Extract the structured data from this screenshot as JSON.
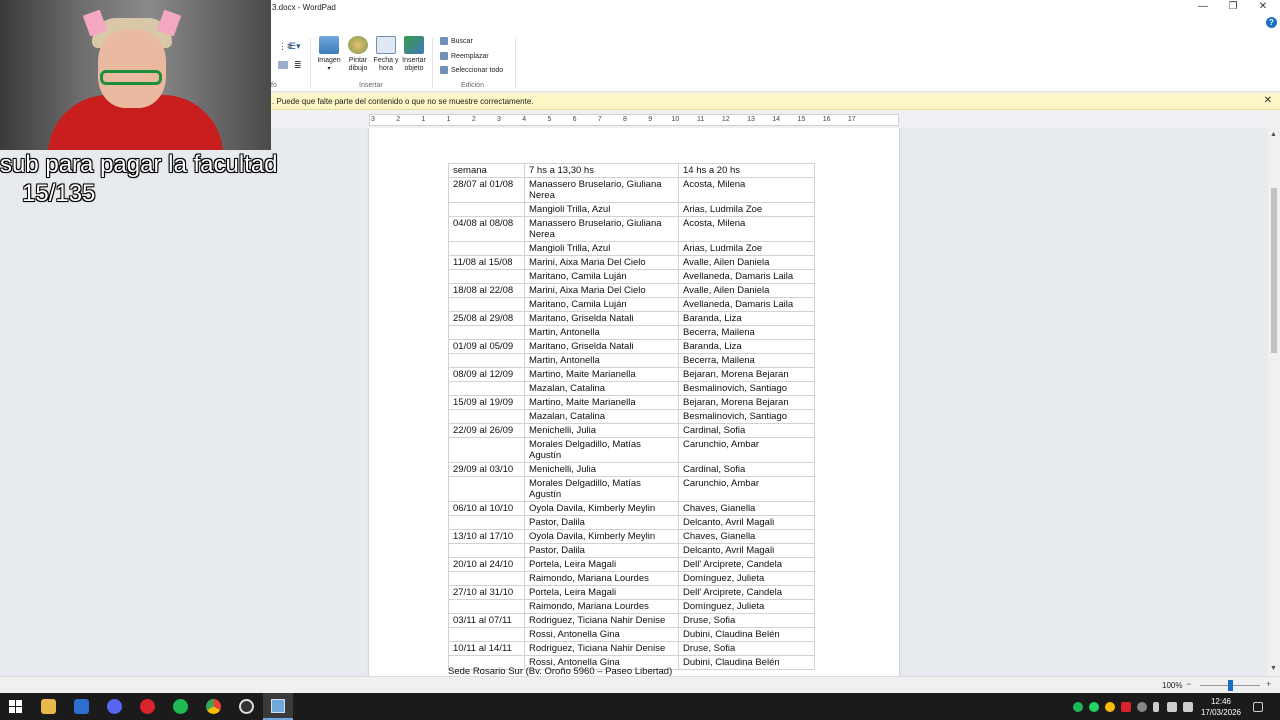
{
  "window": {
    "title": "3.docx - WordPad",
    "minimize": "—",
    "restore": "❐",
    "close": "✕",
    "help": "?"
  },
  "ribbon": {
    "insert_group_label": "Insertar",
    "edit_group_label": "Edición",
    "left_group_label_fragment": "fo",
    "image_label": "Imagen",
    "paint_label": "Pintar dibujo",
    "datetime_label": "Fecha y hora",
    "object_label": "Insertar objeto",
    "find_label": "Buscar",
    "replace_label": "Reemplazar",
    "select_all_label": "Seleccionar todo"
  },
  "infobar": {
    "message": ". Puede que falte parte del contenido o que no se muestre correctamente.",
    "close": "✕"
  },
  "ruler": {
    "ticks": [
      "3",
      "2",
      "1",
      "1",
      "2",
      "3",
      "4",
      "5",
      "6",
      "7",
      "8",
      "9",
      "10",
      "11",
      "12",
      "13",
      "14",
      "15",
      "16",
      "17"
    ]
  },
  "document": {
    "table": {
      "headers": [
        "semana",
        "7 hs a 13,30 hs",
        "14 hs a 20 hs"
      ],
      "rows": [
        [
          "28/07 al 01/08",
          "Manassero Bruselario, Giuliana Nerea",
          "Acosta, Milena"
        ],
        [
          "",
          "Mangioli Trilla, Azul",
          "Arias, Ludmila Zoe"
        ],
        [
          "04/08 al 08/08",
          "Manassero Bruselario, Giuliana Nerea",
          "Acosta, Milena"
        ],
        [
          "",
          "Mangioli Trilla, Azul",
          "Arias, Ludmila Zoe"
        ],
        [
          "11/08 al 15/08",
          "Marini, Aixa Maria Del Cielo",
          "Avalle, Ailen Daniela"
        ],
        [
          "",
          "Maritano, Camila Luján",
          "Avellaneda, Damaris Laila"
        ],
        [
          "18/08 al 22/08",
          "Marini, Aixa Maria Del Cielo",
          "Avalle, Ailen Daniela"
        ],
        [
          "",
          "Maritano, Camila Luján",
          "Avellaneda, Damaris Laila"
        ],
        [
          "25/08 al 29/08",
          "Maritano, Griselda Natali",
          "Baranda, Liza"
        ],
        [
          "",
          "Martin, Antonella",
          "Becerra, Mailena"
        ],
        [
          "01/09 al 05/09",
          "Maritano, Griselda Natali",
          "Baranda, Liza"
        ],
        [
          "",
          "Martin, Antonella",
          "Becerra, Mailena"
        ],
        [
          "08/09 al 12/09",
          "Martino, Maite Marianella",
          "Bejaran, Morena Bejaran"
        ],
        [
          "",
          "Mazalan, Catalina",
          "Besmalinovich, Santiago"
        ],
        [
          "15/09 al 19/09",
          "Martino, Maite Marianella",
          "Bejaran, Morena Bejaran"
        ],
        [
          "",
          "Mazalan, Catalina",
          "Besmalinovich, Santiago"
        ],
        [
          "22/09 al 26/09",
          "Menichelli, Julia",
          "Cardinal, Sofia"
        ],
        [
          "",
          "Morales Delgadillo, Matías Agustín",
          "Carunchio, Ambar"
        ],
        [
          "29/09 al 03/10",
          "Menichelli, Julia",
          "Cardinal, Sofia"
        ],
        [
          "",
          "Morales Delgadillo, Matías Agustín",
          "Carunchio, Ambar"
        ],
        [
          "06/10 al 10/10",
          "Oyola Davila, Kimberly Meylin",
          "Chaves, Gianella"
        ],
        [
          "",
          "Pastor, Dalila",
          "Delcanto, Avril Magali"
        ],
        [
          "13/10 al 17/10",
          "Oyola Davila, Kimberly Meylin",
          "Chaves, Gianella"
        ],
        [
          "",
          "Pastor, Dalila",
          "Delcanto, Avril Magali"
        ],
        [
          "20/10 al 24/10",
          "Portela, Leira Magali",
          "Dell' Arciprete, Candela"
        ],
        [
          "",
          "Raimondo, Mariana Lourdes",
          "Domínguez, Julieta"
        ],
        [
          "27/10 al 31/10",
          "Portela, Leira Magali",
          "Dell' Arciprete, Candela"
        ],
        [
          "",
          "Raimondo, Mariana Lourdes",
          "Domínguez, Julieta"
        ],
        [
          "03/11 al 07/11",
          "Rodriguez, Ticiana Nahir Denise",
          "Druse, Sofia"
        ],
        [
          "",
          "Rossi, Antonella Gina",
          "Dubini, Claudina Belén"
        ],
        [
          "10/11 al 14/11",
          "Rodriguez, Ticiana Nahir Denise",
          "Druse, Sofia"
        ],
        [
          "",
          "Rossi, Antonella Gina",
          "Dubini, Claudina Belén"
        ]
      ]
    },
    "footer_text": "Sede Rosario Sur (Bv. Oroño 5960 – Paseo Libertad)"
  },
  "statusbar": {
    "zoom": "100%",
    "zoom_out": "−",
    "zoom_in": "+"
  },
  "taskbar": {
    "time": "12:46",
    "date": "17/03/2026"
  },
  "stream_overlay": {
    "line1": "sub para pagar la facultad",
    "line2": "15/135"
  }
}
